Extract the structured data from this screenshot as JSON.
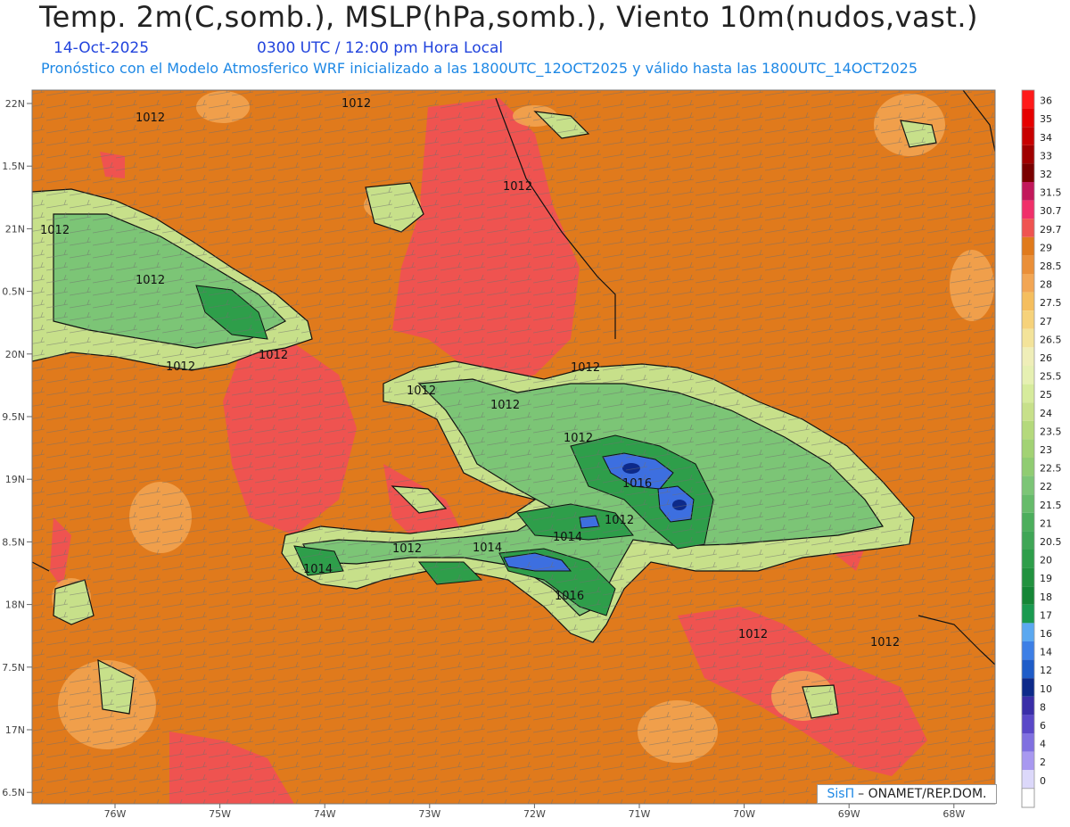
{
  "header": {
    "title": "Temp. 2m(C,somb.), MSLP(hPa,somb.), Viento 10m(nudos,vast.)",
    "date": "14-Oct-2025",
    "time": "0300 UTC / 12:00 pm Hora Local",
    "forecast_note": "Pronóstico con el Modelo Atmosferico WRF inicializado a las 1800UTC_12OCT2025 y válido hasta las  1800UTC_14OCT2025"
  },
  "map": {
    "lat_labels": [
      "22N",
      "1.5N",
      "21N",
      "0.5N",
      "20N",
      "9.5N",
      "19N",
      "8.5N",
      "18N",
      "7.5N",
      "17N",
      "6.5N"
    ],
    "lon_labels": [
      "76W",
      "75W",
      "74W",
      "73W",
      "72W",
      "71W",
      "70W",
      "69W",
      "68W"
    ],
    "isobar_labels": [
      "1012",
      "1012",
      "1012",
      "1012",
      "1012",
      "1012",
      "1012",
      "1012",
      "1012",
      "1012",
      "1012",
      "1012",
      "1014",
      "1014",
      "1014",
      "1016",
      "1012",
      "1012",
      "1012"
    ],
    "colors": {
      "sea": "#e07a1c",
      "warm": "#ef5350",
      "sand": "#f2a654",
      "green_light": "#c7e08a",
      "green_mid": "#7cc576",
      "green_dark": "#2e9e4a",
      "blue": "#3d6fe0"
    }
  },
  "legend": {
    "levels": [
      {
        "label": "36",
        "color": "#ff1a1a"
      },
      {
        "label": "35",
        "color": "#e60000"
      },
      {
        "label": "34",
        "color": "#c80000"
      },
      {
        "label": "33",
        "color": "#a00000"
      },
      {
        "label": "32",
        "color": "#7a0000"
      },
      {
        "label": "31.5",
        "color": "#c2185b"
      },
      {
        "label": "30.7",
        "color": "#f0306a"
      },
      {
        "label": "29.7",
        "color": "#ef5350"
      },
      {
        "label": "29",
        "color": "#e07a1c"
      },
      {
        "label": "28.5",
        "color": "#ea8f38"
      },
      {
        "label": "28",
        "color": "#f2a654"
      },
      {
        "label": "27.5",
        "color": "#f5be5e"
      },
      {
        "label": "27",
        "color": "#f6d27a"
      },
      {
        "label": "26.5",
        "color": "#f3e39a"
      },
      {
        "label": "26",
        "color": "#efeeb8"
      },
      {
        "label": "25.5",
        "color": "#e6f0b2"
      },
      {
        "label": "25",
        "color": "#d6eb9c"
      },
      {
        "label": "24",
        "color": "#c7e08a"
      },
      {
        "label": "23.5",
        "color": "#b4d97c"
      },
      {
        "label": "23",
        "color": "#a2d274"
      },
      {
        "label": "22.5",
        "color": "#90cc72"
      },
      {
        "label": "22",
        "color": "#7cc576"
      },
      {
        "label": "21.5",
        "color": "#66bb6a"
      },
      {
        "label": "21",
        "color": "#4cae5c"
      },
      {
        "label": "20.5",
        "color": "#3fa656"
      },
      {
        "label": "20",
        "color": "#2e9e4a"
      },
      {
        "label": "19",
        "color": "#22923f"
      },
      {
        "label": "18",
        "color": "#158636"
      },
      {
        "label": "17",
        "color": "#1a9a50"
      },
      {
        "label": "16",
        "color": "#5ba8f0"
      },
      {
        "label": "14",
        "color": "#3d7fe6"
      },
      {
        "label": "12",
        "color": "#1e5cc8"
      },
      {
        "label": "10",
        "color": "#0d2a8a"
      },
      {
        "label": "8",
        "color": "#3a2ea8"
      },
      {
        "label": "6",
        "color": "#5a48c8"
      },
      {
        "label": "4",
        "color": "#8070e0"
      },
      {
        "label": "2",
        "color": "#a898f0"
      },
      {
        "label": "0",
        "color": "#dcd8fa"
      }
    ],
    "bottom_color": "#ffffff"
  },
  "credit": {
    "symbol": "SisΠ",
    "text": "– ONAMET/REP.DOM."
  }
}
